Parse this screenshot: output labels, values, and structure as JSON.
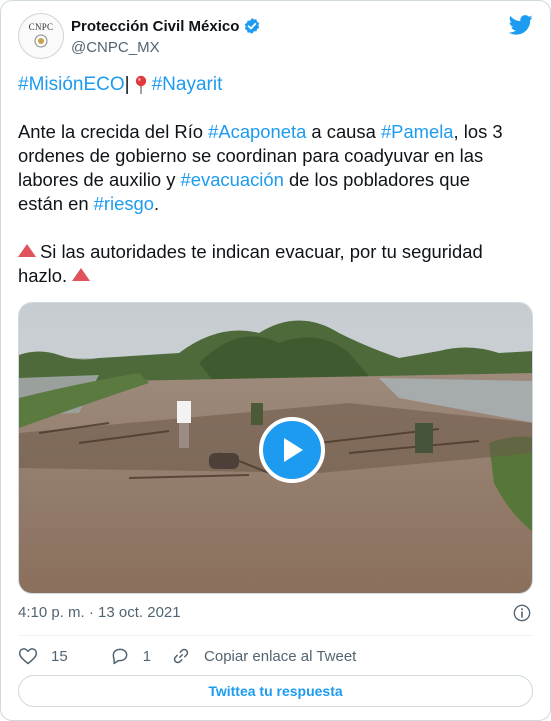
{
  "author": {
    "name": "Protección Civil México",
    "handle": "@CNPC_MX",
    "avatar_text": "CNPC",
    "verified_icon": "verified-badge-icon"
  },
  "header_icon": "twitter-bird-icon",
  "tweet": {
    "line1": {
      "hashtag1": "#MisiónECO",
      "separator": "|",
      "pin_icon": "round-pushpin-icon",
      "hashtag2": "#Nayarit"
    },
    "paragraph": {
      "t1": "Ante la crecida del Río ",
      "h1": "#Acaponeta",
      "t2": " a causa ",
      "h2": "#Pamela",
      "t3": ", los 3",
      "t4": "ordenes de gobierno se coordinan para coadyuvar en las",
      "t5": "labores de auxilio y ",
      "h3": "#evacuación",
      "t6": " de los pobladores que",
      "t7": "están en ",
      "h4": "#riesgo",
      "t8": "."
    },
    "warning": {
      "icon": "red-triangle-icon",
      "t1": "Si las autoridades te indican evacuar, por tu seguridad",
      "t2": "hazlo."
    },
    "media": {
      "type": "video",
      "play_icon": "play-icon"
    },
    "timestamp": "4:10 p. m. · 13 oct. 2021",
    "info_icon": "info-icon"
  },
  "actions": {
    "likes": "15",
    "replies": "1",
    "copy_link": "Copiar enlace al Tweet"
  },
  "reply_button": "Twittea tu respuesta",
  "colors": {
    "link": "#1d9bf0",
    "text": "#0f1419",
    "secondary": "#536471",
    "warning": "#e0525c",
    "border": "#cfd9de"
  }
}
